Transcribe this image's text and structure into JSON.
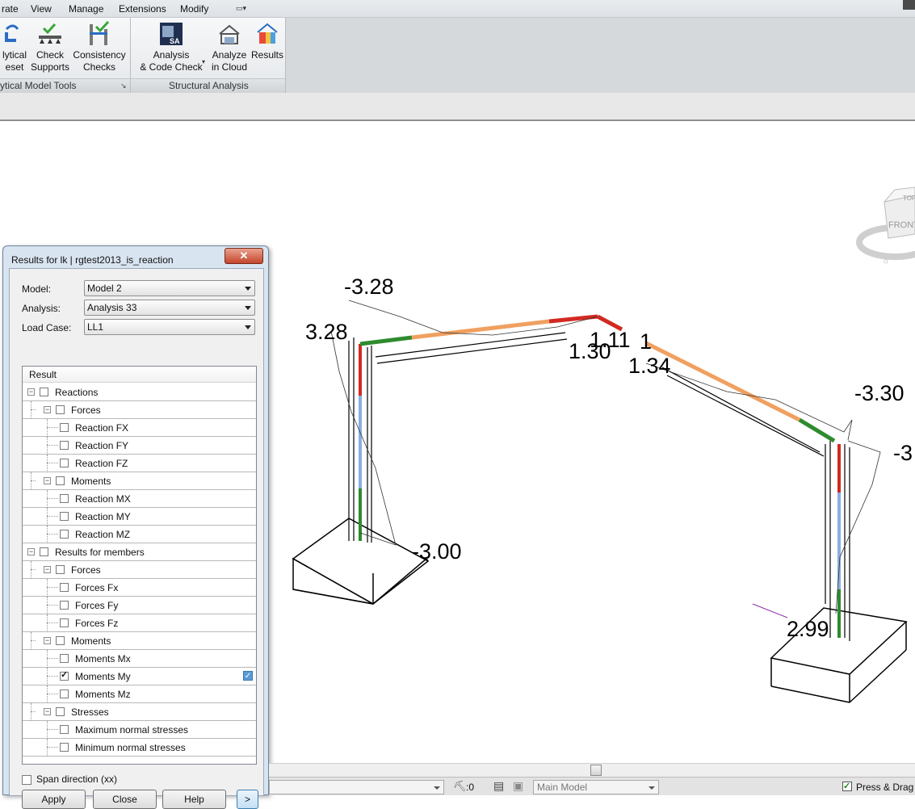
{
  "menu": {
    "tabs": [
      "rate",
      "View",
      "Manage",
      "Extensions",
      "Modify"
    ]
  },
  "ribbon": {
    "panels": [
      {
        "label": "ytical Model Tools",
        "buttons": [
          {
            "line1": "lytical",
            "line2": "eset",
            "icon": "analytical-reset-icon"
          },
          {
            "line1": "Check",
            "line2": "Supports",
            "icon": "check-supports-icon"
          },
          {
            "line1": "Consistency",
            "line2": "Checks",
            "icon": "consistency-checks-icon"
          }
        ]
      },
      {
        "label": "Structural Analysis",
        "buttons": [
          {
            "line1": "Analysis",
            "line2": "& Code Check",
            "icon": "robot-structural-analysis-icon"
          },
          {
            "line1": "Analyze",
            "line2": "in Cloud",
            "icon": "analyze-cloud-icon"
          },
          {
            "line1": "Results",
            "line2": "",
            "icon": "results-icon"
          }
        ]
      }
    ]
  },
  "drawing": {
    "values": [
      "-3.28",
      "3.28",
      "1.11",
      "1.34",
      "-3.30",
      "-3.00",
      "2.99",
      "1.30",
      "-3",
      "1"
    ],
    "colors": {
      "red": "#d22a22",
      "green": "#2e8b2e",
      "blue": "#8aaee0",
      "orange": "#f0a060"
    },
    "view_cube": {
      "face": "FRONT",
      "top": "TOP"
    }
  },
  "dialog": {
    "title": "Results for lk | rgtest2013_is_reaction",
    "close_label": "✕",
    "model_label": "Model:",
    "model_value": "Model 2",
    "analysis_label": "Analysis:",
    "analysis_value": "Analysis 33",
    "loadcase_label": "Load Case:",
    "loadcase_value": "LL1",
    "tree_header": "Result",
    "tree": [
      {
        "label": "Reactions",
        "level": 0,
        "expander": true,
        "checked": false
      },
      {
        "label": "Forces",
        "level": 1,
        "expander": true,
        "checked": false
      },
      {
        "label": "Reaction FX",
        "level": 2,
        "expander": false,
        "checked": false
      },
      {
        "label": "Reaction FY",
        "level": 2,
        "expander": false,
        "checked": false
      },
      {
        "label": "Reaction FZ",
        "level": 2,
        "expander": false,
        "checked": false
      },
      {
        "label": "Moments",
        "level": 1,
        "expander": true,
        "checked": false
      },
      {
        "label": "Reaction MX",
        "level": 2,
        "expander": false,
        "checked": false
      },
      {
        "label": "Reaction MY",
        "level": 2,
        "expander": false,
        "checked": false
      },
      {
        "label": "Reaction MZ",
        "level": 2,
        "expander": false,
        "checked": false
      },
      {
        "label": "Results for members",
        "level": 0,
        "expander": true,
        "checked": false
      },
      {
        "label": "Forces",
        "level": 1,
        "expander": true,
        "checked": false
      },
      {
        "label": "Forces Fx",
        "level": 2,
        "expander": false,
        "checked": false
      },
      {
        "label": "Forces Fy",
        "level": 2,
        "expander": false,
        "checked": false
      },
      {
        "label": "Forces Fz",
        "level": 2,
        "expander": false,
        "checked": false
      },
      {
        "label": "Moments",
        "level": 1,
        "expander": true,
        "checked": false
      },
      {
        "label": "Moments Mx",
        "level": 2,
        "expander": false,
        "checked": false
      },
      {
        "label": "Moments My",
        "level": 2,
        "expander": false,
        "checked": true,
        "selected_marker": true
      },
      {
        "label": "Moments Mz",
        "level": 2,
        "expander": false,
        "checked": false
      },
      {
        "label": "Stresses",
        "level": 1,
        "expander": true,
        "checked": false
      },
      {
        "label": "Maximum normal stresses",
        "level": 2,
        "expander": false,
        "checked": false
      },
      {
        "label": "Minimum normal stresses",
        "level": 2,
        "expander": false,
        "checked": false
      }
    ],
    "span_direction_label": "Span direction (xx)",
    "buttons": {
      "apply": "Apply",
      "close": "Close",
      "help": "Help",
      "next": ">"
    }
  },
  "status": {
    "zero_label": ":0",
    "model_select": "Main Model",
    "press_drag_label": "Press & Drag",
    "press_drag_checked": true
  }
}
